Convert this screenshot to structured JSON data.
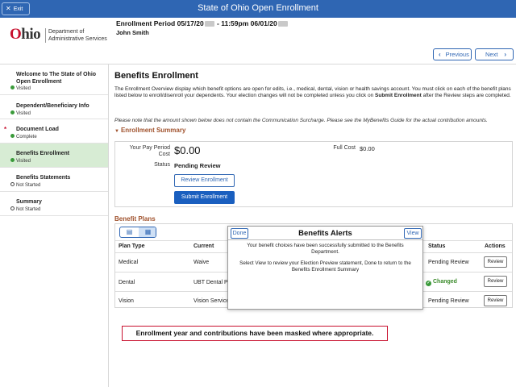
{
  "topbar": {
    "exit_label": "Exit",
    "title": "State of Ohio Open Enrollment"
  },
  "header": {
    "logo_text": "Ohio",
    "department_line1": "Department of",
    "department_line2": "Administrative Services",
    "enrollment_period_label": "Enrollment Period",
    "period_start": "05/17/20",
    "period_start_time": " - 11:59pm",
    "period_end": "06/01/20",
    "user_name": "John Smith",
    "previous_label": "Previous",
    "next_label": "Next"
  },
  "sidebar": {
    "items": [
      {
        "label": "Welcome to The State of Ohio Open Enrollment",
        "status": "Visited",
        "status_type": "visited"
      },
      {
        "label": "Dependent/Beneficiary Info",
        "status": "Visited",
        "status_type": "visited"
      },
      {
        "label": "Document Load",
        "status": "Complete",
        "status_type": "complete",
        "required": true
      },
      {
        "label": "Benefits Enrollment",
        "status": "Visited",
        "status_type": "visited",
        "active": true
      },
      {
        "label": "Benefits Statements",
        "status": "Not Started",
        "status_type": "not-started"
      },
      {
        "label": "Summary",
        "status": "Not Started",
        "status_type": "not-started"
      }
    ]
  },
  "main": {
    "title": "Benefits Enrollment",
    "intro_part1": "The Enrollment Overview display which benefit options are open for edits, i.e., medical, dental, vision or health savings account. You must click on each of the benefit plans listed below to enroll/disenroll your dependents. Your election changes will not be completed unless you click on ",
    "intro_bold": "Submit Enrollment",
    "intro_part2": " after the Review steps are completed.",
    "note": "Please note that the amount shown below does not contain the Communication Surcharge. Please see the MyBenefits Guide for the actual contribution amounts.",
    "summary": {
      "heading": "Enrollment Summary",
      "pay_period_label_1": "Your Pay Period",
      "pay_period_label_2": "Cost",
      "pay_period_value": "$0.00",
      "full_cost_label": "Full Cost",
      "full_cost_value": "$0.00",
      "status_label": "Status",
      "status_value": "Pending Review",
      "review_button": "Review Enrollment",
      "submit_button": "Submit Enrollment"
    },
    "plans": {
      "heading": "Benefit Plans",
      "columns": {
        "plan_type": "Plan Type",
        "current": "Current",
        "status": "Status",
        "actions": "Actions"
      },
      "rows": [
        {
          "plan_type": "Medical",
          "current": "Waive",
          "status": "Pending Review",
          "changed": false,
          "action": "Review"
        },
        {
          "plan_type": "Dental",
          "current": "UBT Dental P",
          "status": "Changed",
          "changed": true,
          "action": "Review"
        },
        {
          "plan_type": "Vision",
          "current": "Vision Service",
          "status": "Pending Review",
          "changed": false,
          "action": "Review"
        }
      ]
    },
    "mask_notice": "Enrollment year and contributions have been masked where appropriate."
  },
  "modal": {
    "title": "Benefits Alerts",
    "done_label": "Done",
    "view_label": "View",
    "message1": "Your benefit choices have been successfully submitted to the Benefits Department.",
    "message2": "Select View to review your Election Preview statement, Done to return to the Benefits Enrollment Summary"
  },
  "colors": {
    "topbar": "#2f66b3",
    "active_item": "#d7ecd4",
    "section_heading": "#a0522d",
    "primary_button": "#1a5fbf",
    "status_green": "#3a9a3a",
    "notice_border": "#c8102e"
  }
}
